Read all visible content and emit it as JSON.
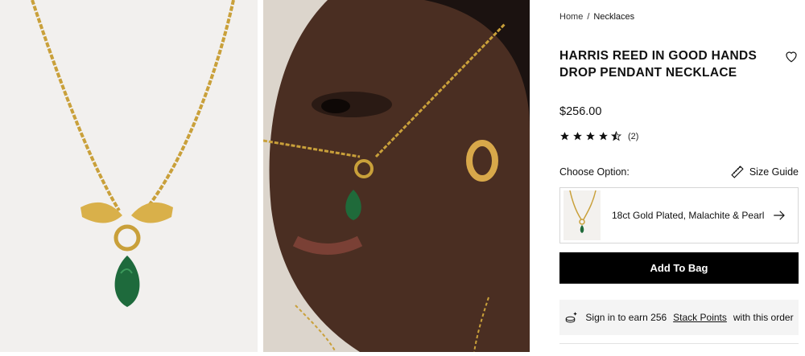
{
  "breadcrumb": {
    "home": "Home",
    "separator": "/",
    "current": "Necklaces"
  },
  "product": {
    "title": "HARRIS REED IN GOOD HANDS DROP PENDANT NECKLACE",
    "price": "$256.00",
    "rating": 4.5,
    "review_count": "(2)"
  },
  "options": {
    "label": "Choose Option:",
    "size_guide": "Size Guide",
    "selected": "18ct Gold Plated, Malachite & Pearl"
  },
  "cta": {
    "add_to_bag": "Add To Bag"
  },
  "points": {
    "prefix": "Sign in to earn 256",
    "link": "Stack Points",
    "suffix": "with this order"
  },
  "gallery": [
    {
      "alt": "necklace product shot"
    },
    {
      "alt": "model wearing necklace"
    }
  ],
  "colors": {
    "gold": "#c9a03a",
    "malachite": "#1f6a3a",
    "button": "#000000"
  }
}
